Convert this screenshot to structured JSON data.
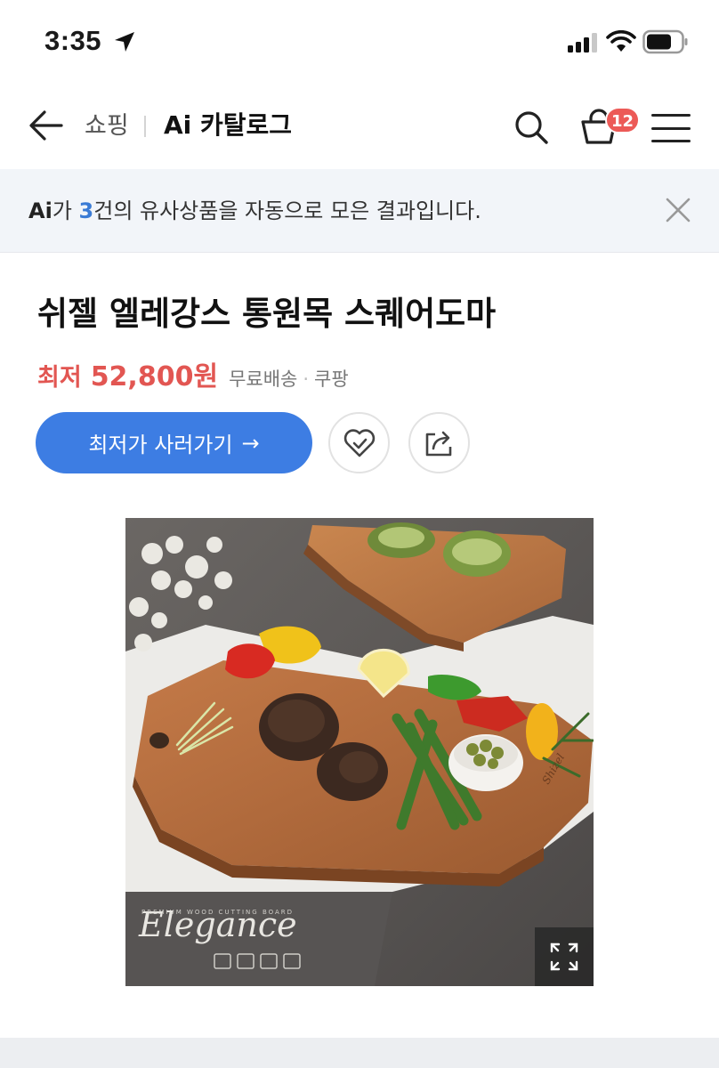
{
  "status_bar": {
    "time": "3:35"
  },
  "header": {
    "back_icon": "arrow-left-icon",
    "breadcrumb_shop": "쇼핑",
    "title": "Ai 카탈로그",
    "cart_count": "12"
  },
  "ai_banner": {
    "prefix": "Ai",
    "text_before_count": "가 ",
    "count": "3",
    "text_after_count": "건의 유사상품을 자동으로 모은 결과입니다."
  },
  "product": {
    "title": "쉬젤 엘레강스 통원목 스퀘어도마",
    "price_label": "최저",
    "price": "52,800원",
    "shipping": "무료배송",
    "separator": "·",
    "seller": "쿠팡",
    "buy_button": "최저가 사러가기",
    "buy_arrow": "→",
    "image_brand_text": "Elegance",
    "image_brand_subtext": "PREMIUM WOOD CUTTING BOARD",
    "board_engraving": "Shizel"
  },
  "colors": {
    "accent_blue": "#3d7de3",
    "price_red": "#e25652",
    "badge_red": "#ec5a57",
    "banner_bg": "#f2f5f9"
  }
}
